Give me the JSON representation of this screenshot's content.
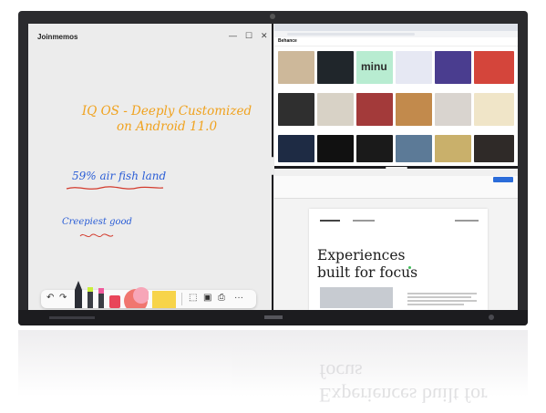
{
  "whiteboard": {
    "app_title": "Joinmemos",
    "window_controls": [
      "—",
      "☐",
      "✕"
    ],
    "handwriting": [
      "IQ OS - Deeply Customized on Android 11.0",
      "59% air fish land",
      "Creepiest good"
    ],
    "toolbar_icons": [
      "undo-icon",
      "redo-icon",
      "pen-icon",
      "marker-icon",
      "highlighter-icon",
      "eraser-icon",
      "shape-icon",
      "sticky-note-icon",
      "select-icon",
      "image-icon",
      "save-icon",
      "more-icon"
    ],
    "toolbar_more": "···"
  },
  "browser": {
    "site_name": "Behance",
    "gallery_title": "minu"
  },
  "word": {
    "heading": "Experiences built for focus"
  },
  "colors": {
    "handwriting_orange": "#f0a21e",
    "handwriting_blue": "#2b5ed6",
    "bezel": "#2b2b2e"
  }
}
